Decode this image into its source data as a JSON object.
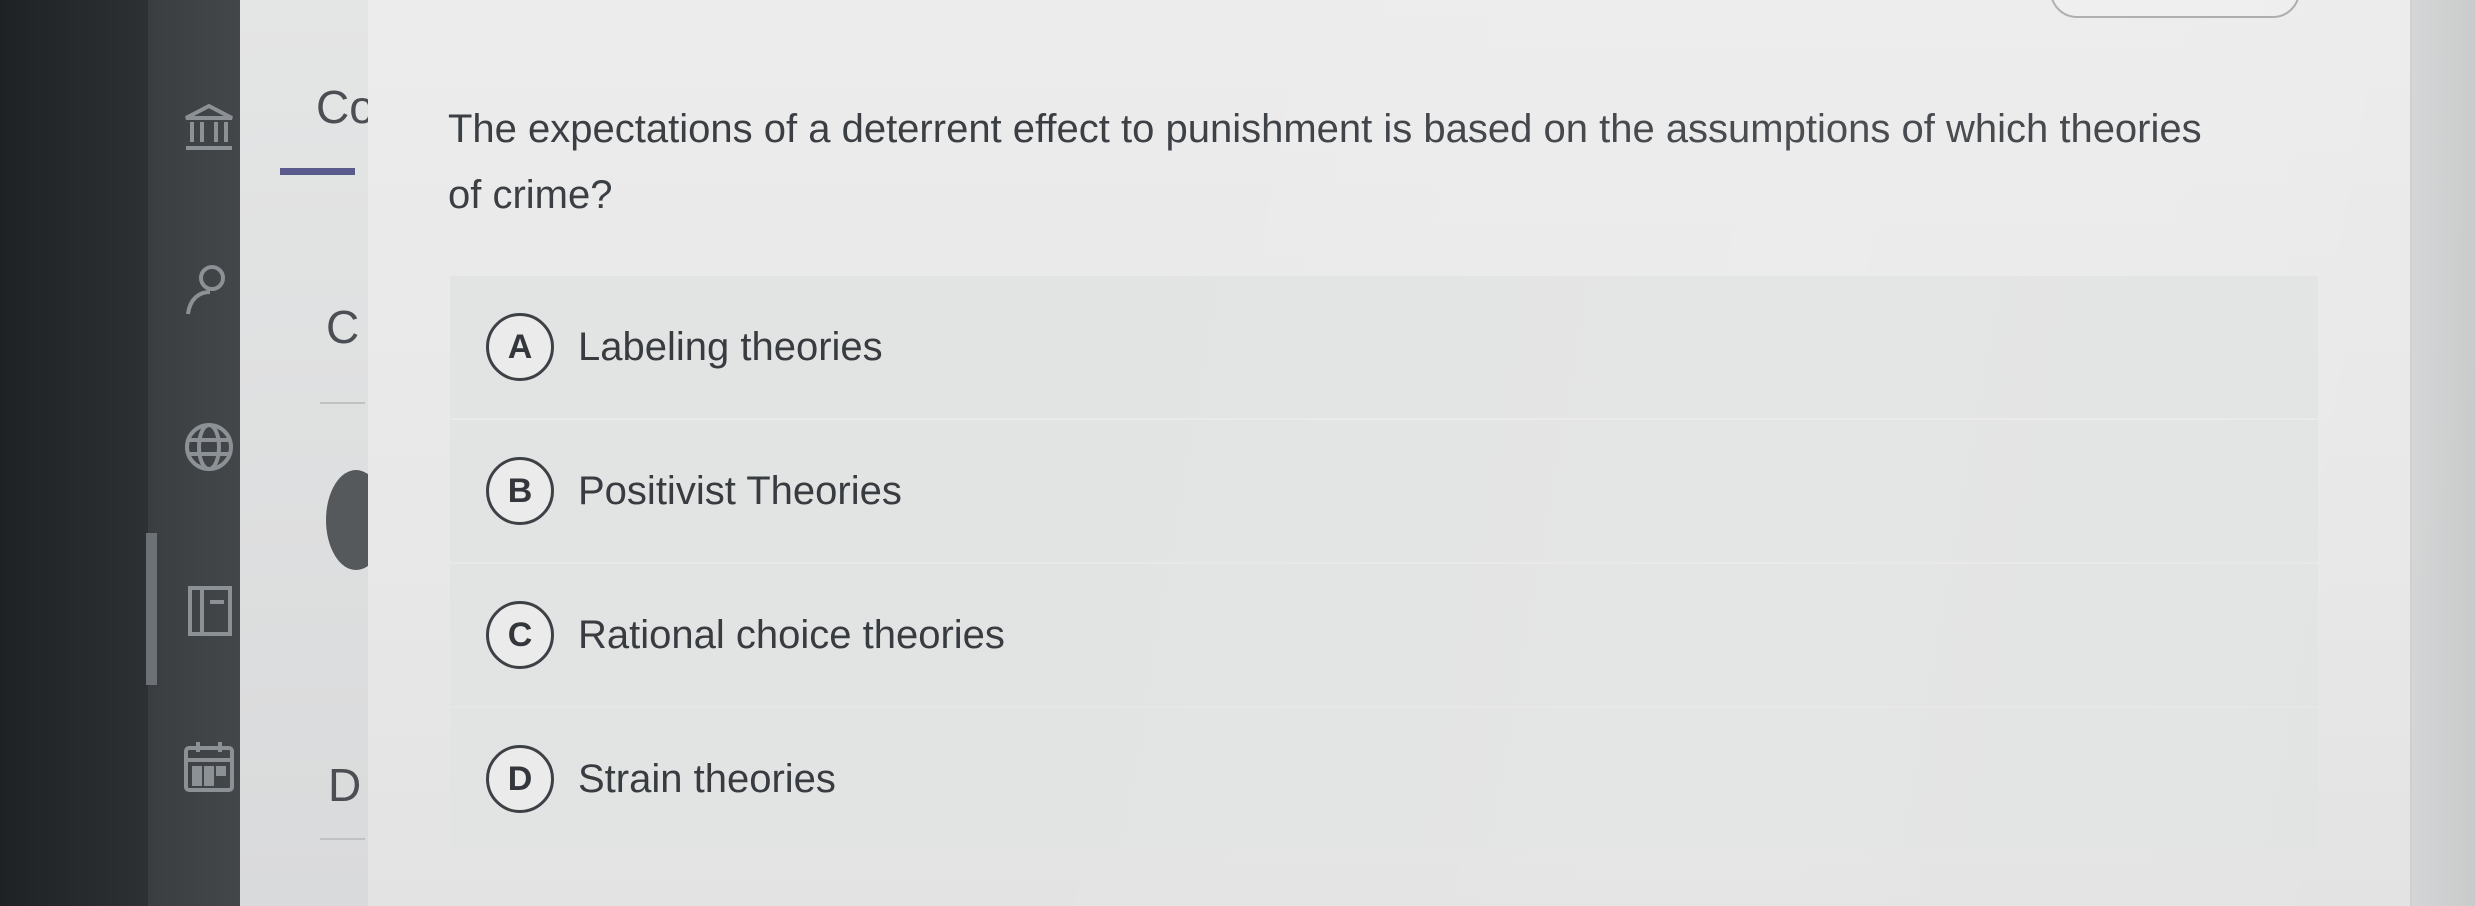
{
  "sidebar": {
    "tab_label_partial": "Co",
    "section_letters": [
      "C",
      "D"
    ],
    "icons": [
      "institution-icon",
      "user-icon",
      "globe-icon",
      "book-icon",
      "calendar-icon"
    ]
  },
  "question": {
    "text": "The expectations of a deterrent effect to punishment is based on the assumptions of which theories of crime?"
  },
  "options": [
    {
      "letter": "A",
      "text": "Labeling theories"
    },
    {
      "letter": "B",
      "text": "Positivist Theories"
    },
    {
      "letter": "C",
      "text": "Rational choice theories"
    },
    {
      "letter": "D",
      "text": "Strain theories"
    }
  ],
  "colors": {
    "accent": "#5b5a8c",
    "nav_background": "#3a3e41",
    "card_background": "#ececec"
  }
}
